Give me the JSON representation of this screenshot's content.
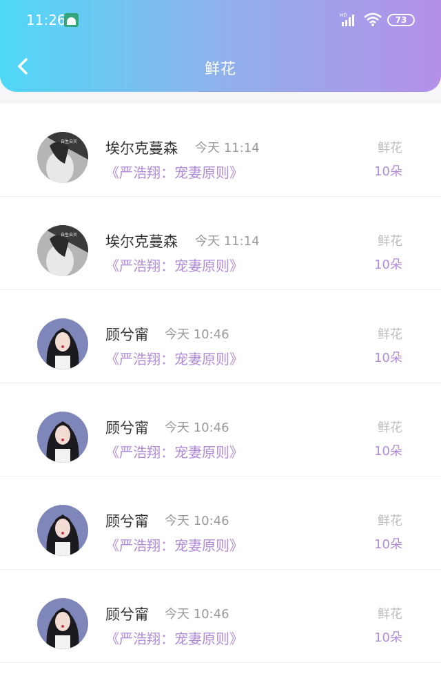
{
  "status_bar": {
    "time": "11:26",
    "battery": "73",
    "icons": [
      "android-notification-icon",
      "signal-hd-icon",
      "wifi-icon",
      "battery-icon"
    ]
  },
  "nav": {
    "title": "鲜花",
    "back_icon": "chevron-left-icon"
  },
  "colors": {
    "header_gradient_start": "#4fd8f7",
    "header_gradient_end": "#b490e9",
    "accent_purple": "#b08bd8",
    "muted_gray": "#9a9a9a"
  },
  "items": [
    {
      "name": "埃尔克蔓森",
      "time": "今天  11:14",
      "book": "《严浩翔：宠妻原则》",
      "gift": "鲜花",
      "count": "10朵",
      "avatar": "grayscale-portrait"
    },
    {
      "name": "埃尔克蔓森",
      "time": "今天  11:14",
      "book": "《严浩翔：宠妻原则》",
      "gift": "鲜花",
      "count": "10朵",
      "avatar": "grayscale-portrait"
    },
    {
      "name": "顾兮甯",
      "time": "今天  10:46",
      "book": "《严浩翔：宠妻原则》",
      "gift": "鲜花",
      "count": "10朵",
      "avatar": "color-portrait"
    },
    {
      "name": "顾兮甯",
      "time": "今天  10:46",
      "book": "《严浩翔：宠妻原则》",
      "gift": "鲜花",
      "count": "10朵",
      "avatar": "color-portrait"
    },
    {
      "name": "顾兮甯",
      "time": "今天  10:46",
      "book": "《严浩翔：宠妻原则》",
      "gift": "鲜花",
      "count": "10朵",
      "avatar": "color-portrait"
    },
    {
      "name": "顾兮甯",
      "time": "今天  10:46",
      "book": "《严浩翔：宠妻原则》",
      "gift": "鲜花",
      "count": "10朵",
      "avatar": "color-portrait"
    }
  ]
}
